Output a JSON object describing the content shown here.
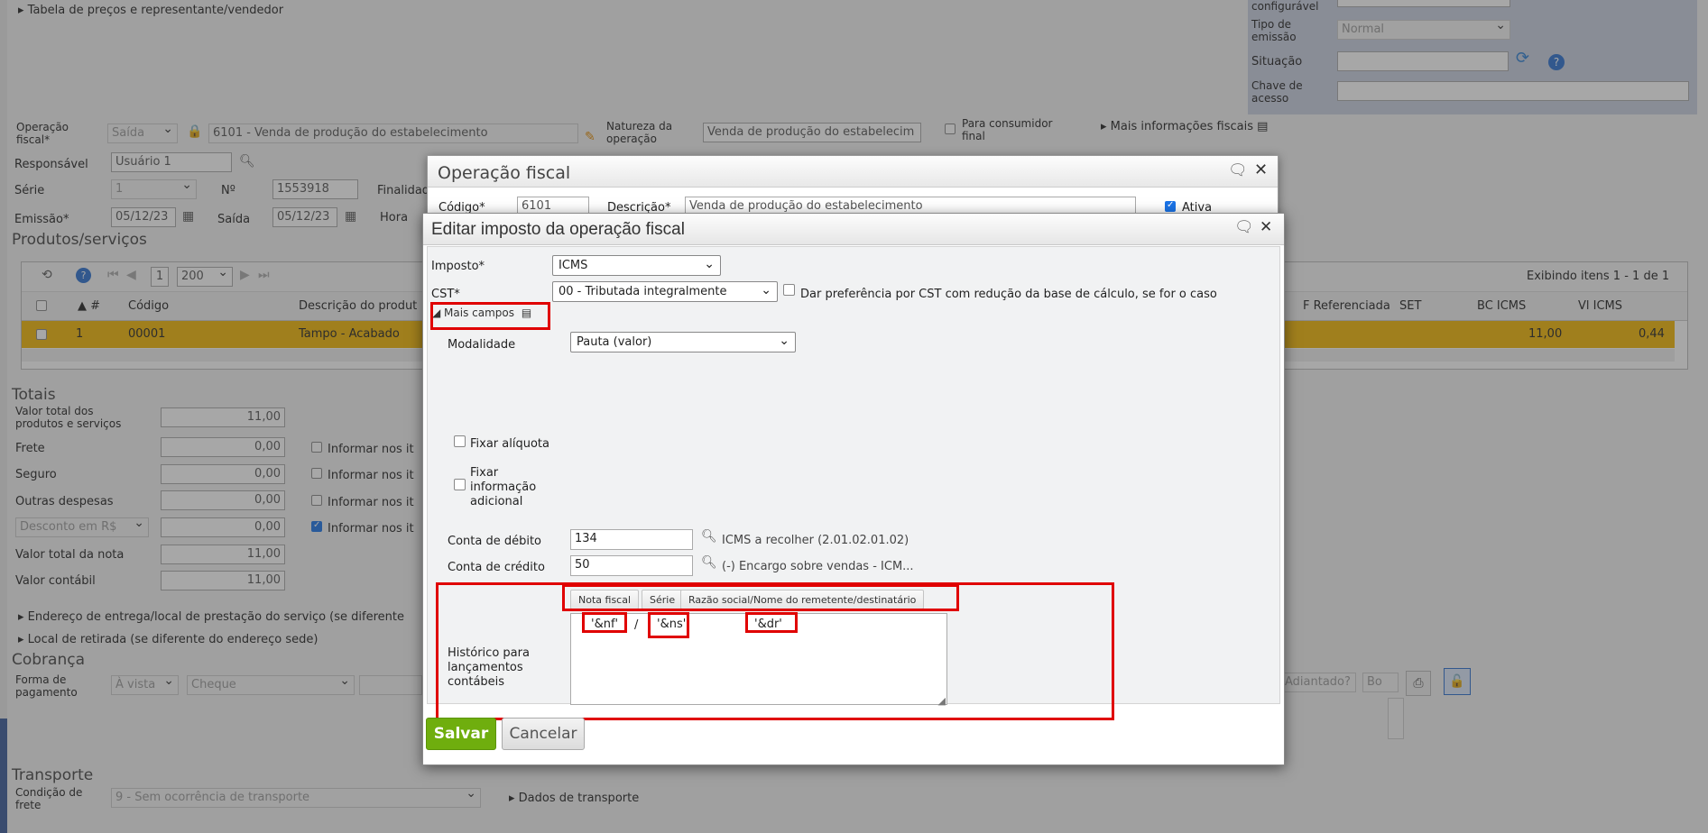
{
  "background": {
    "section_prices": "Tabela de preços e representante/vendedor",
    "top_right": {
      "configuravel_label": "configurável",
      "tipo_emissao_label": "Tipo de emissão",
      "tipo_emissao_value": "Normal",
      "situacao_label": "Situação",
      "chave_label": "Chave de acesso"
    },
    "operacao_fiscal_label": "Operação fiscal*",
    "operacao_tipo": "Saída",
    "operacao_value": "6101 - Venda de produção do estabelecimento",
    "natureza_label": "Natureza da operação",
    "natureza_value": "Venda de produção do estabelecim",
    "consumidor_final_label": "Para consumidor final",
    "mais_info_fiscais": "Mais informações fiscais",
    "responsavel_label": "Responsável",
    "responsavel_value": "Usuário 1",
    "serie_label": "Série",
    "serie_value": "1",
    "numero_label": "Nº",
    "numero_value": "1553918",
    "finalidade_label": "Finalidad",
    "emissao_label": "Emissão*",
    "emissao_value": "05/12/23",
    "saida_label": "Saída",
    "saida_value": "05/12/23",
    "hora_label": "Hora",
    "produtos_title": "Produtos/serviços",
    "pager_page": "1",
    "pager_size": "200",
    "exibindo": "Exibindo itens 1 - 1 de 1",
    "columns": [
      "#",
      "Código",
      "Descrição do produt",
      "F Referenciada",
      "SET",
      "BC ICMS",
      "Vl ICMS"
    ],
    "row": {
      "num": "1",
      "codigo": "00001",
      "descricao": "Tampo - Acabado",
      "bc_icms": "11,00",
      "vl_icms": "0,44"
    },
    "totais_title": "Totais",
    "totais": [
      {
        "label": "Valor total dos produtos e serviços",
        "value": "11,00"
      },
      {
        "label": "Frete",
        "value": "0,00",
        "check": "Informar nos it"
      },
      {
        "label": "Seguro",
        "value": "0,00",
        "check": "Informar nos it"
      },
      {
        "label": "Outras despesas",
        "value": "0,00",
        "check": "Informar nos it"
      },
      {
        "label": "Desconto em R$",
        "value": "0,00",
        "check": "Informar nos it"
      },
      {
        "label": "Valor total da nota",
        "value": "11,00"
      },
      {
        "label": "Valor contábil",
        "value": "11,00"
      }
    ],
    "endereco_entrega": "Endereço de entrega/local de prestação do serviço (se diferente",
    "local_retirada": "Local de retirada (se diferente do endereço sede)",
    "cobranca_title": "Cobrança",
    "forma_pagamento_label": "Forma de pagamento",
    "forma_pagamento_value": "À vista",
    "forma_pagamento_tipo": "Cheque",
    "adiantado_label": "Adiantado?",
    "bo_label": "Bo",
    "transporte_title": "Transporte",
    "condicao_frete_label": "Condição de frete",
    "condicao_frete_value": "9 - Sem ocorrência de transporte",
    "dados_transporte": "Dados de transporte"
  },
  "modal_operacao": {
    "title": "Operação fiscal",
    "codigo_label": "Código*",
    "codigo_value": "6101",
    "descricao_label": "Descrição*",
    "descricao_value": "Venda de produção do estabelecimento",
    "ativa_label": "Ativa"
  },
  "modal_imposto": {
    "title": "Editar imposto da operação fiscal",
    "imposto_label": "Imposto*",
    "imposto_value": "ICMS",
    "cst_label": "CST*",
    "cst_value": "00 - Tributada integralmente",
    "preferencia_label": "Dar preferência por CST com redução da base de cálculo, se for o caso",
    "mais_campos": "Mais campos",
    "modalidade_label": "Modalidade",
    "modalidade_value": "Pauta (valor)",
    "fixar_aliquota": "Fixar alíquota",
    "fixar_info_adicional": "Fixar informação adicional",
    "conta_debito_label": "Conta de débito",
    "conta_debito_value": "134",
    "conta_debito_desc": "ICMS a recolher (2.01.02.01.02)",
    "conta_credito_label": "Conta de crédito",
    "conta_credito_value": "50",
    "conta_credito_desc": "(-) Encargo sobre vendas - ICM...",
    "tokens": [
      "Nota fiscal",
      "Série",
      "Razão social/Nome do remetente/destinatário"
    ],
    "historico_label": "Histórico para lançamentos contábeis",
    "historico_parts": [
      "'&nf'",
      "/",
      "'&ns'",
      "'&dr'"
    ],
    "save_label": "Salvar",
    "cancel_label": "Cancelar"
  },
  "colors": {
    "accent_green": "#6fae0e",
    "highlight_red": "#e00000",
    "row_yellow": "#f2b705"
  }
}
